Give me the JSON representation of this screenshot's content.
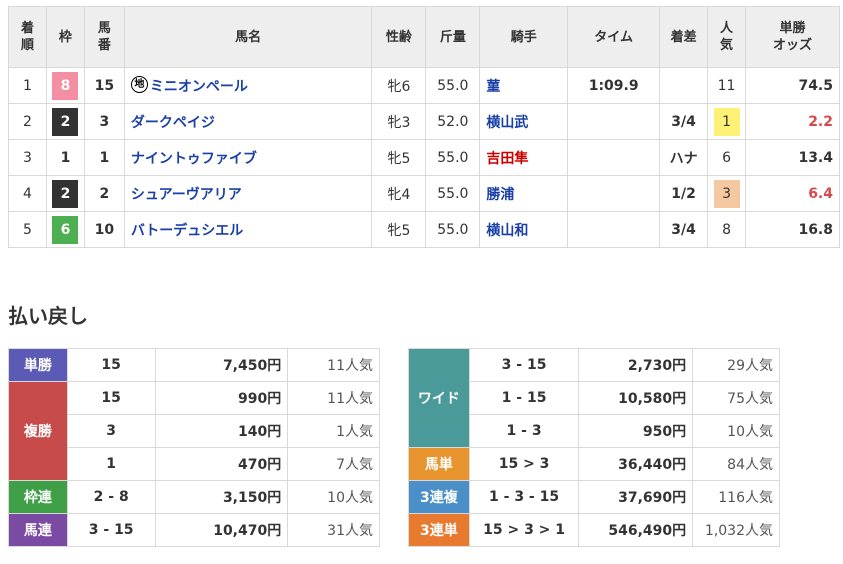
{
  "results": {
    "headers": {
      "chaku": [
        "着",
        "順"
      ],
      "waku": "枠",
      "umaban": [
        "馬",
        "番"
      ],
      "name": "馬名",
      "sexage": "性齢",
      "weight": "斤量",
      "jockey": "騎手",
      "time": "タイム",
      "margin": "着差",
      "pop": [
        "人",
        "気"
      ],
      "odds": [
        "単勝",
        "オッズ"
      ]
    },
    "rows": [
      {
        "chaku": "1",
        "waku": "8",
        "umaban": "15",
        "chi": "地",
        "name": "ミニオンペール",
        "sexage": "牝6",
        "weight": "55.0",
        "jockey": "菫",
        "time": "1:09.9",
        "margin": "",
        "pop": "11",
        "odds": "74.5"
      },
      {
        "chaku": "2",
        "waku": "2",
        "umaban": "3",
        "chi": "",
        "name": "ダークペイジ",
        "sexage": "牝3",
        "weight": "52.0",
        "jockey": "横山武",
        "time": "",
        "margin": "3/4",
        "pop": "1",
        "odds": "2.2"
      },
      {
        "chaku": "3",
        "waku": "1",
        "umaban": "1",
        "chi": "",
        "name": "ナイントゥファイブ",
        "sexage": "牝5",
        "weight": "55.0",
        "jockey": "吉田隼",
        "time": "",
        "margin": "ハナ",
        "pop": "6",
        "odds": "13.4"
      },
      {
        "chaku": "4",
        "waku": "2",
        "umaban": "2",
        "chi": "",
        "name": "シュアーヴアリア",
        "sexage": "牝4",
        "weight": "55.0",
        "jockey": "勝浦",
        "time": "",
        "margin": "1/2",
        "pop": "3",
        "odds": "6.4"
      },
      {
        "chaku": "5",
        "waku": "6",
        "umaban": "10",
        "chi": "",
        "name": "バトーデュシエル",
        "sexage": "牝5",
        "weight": "55.0",
        "jockey": "横山和",
        "time": "",
        "margin": "3/4",
        "pop": "8",
        "odds": "16.8"
      }
    ]
  },
  "payout_title": "払い戻し",
  "payout_left": [
    {
      "label": "単勝",
      "lines": [
        {
          "comb": "15",
          "amount": "7,450円",
          "pop": "11人気"
        }
      ]
    },
    {
      "label": "複勝",
      "lines": [
        {
          "comb": "15",
          "amount": "990円",
          "pop": "11人気"
        },
        {
          "comb": "3",
          "amount": "140円",
          "pop": "1人気"
        },
        {
          "comb": "1",
          "amount": "470円",
          "pop": "7人気"
        }
      ]
    },
    {
      "label": "枠連",
      "lines": [
        {
          "comb": "2 - 8",
          "amount": "3,150円",
          "pop": "10人気"
        }
      ]
    },
    {
      "label": "馬連",
      "lines": [
        {
          "comb": "3 - 15",
          "amount": "10,470円",
          "pop": "31人気"
        }
      ]
    }
  ],
  "payout_right": [
    {
      "label": "ワイド",
      "lines": [
        {
          "comb": "3 - 15",
          "amount": "2,730円",
          "pop": "29人気"
        },
        {
          "comb": "1 - 15",
          "amount": "10,580円",
          "pop": "75人気"
        },
        {
          "comb": "1 - 3",
          "amount": "950円",
          "pop": "10人気"
        }
      ]
    },
    {
      "label": "馬単",
      "lines": [
        {
          "comb": "15 > 3",
          "amount": "36,440円",
          "pop": "84人気"
        }
      ]
    },
    {
      "label": "3連複",
      "lines": [
        {
          "comb": "1 - 3 - 15",
          "amount": "37,690円",
          "pop": "116人気"
        }
      ]
    },
    {
      "label": "3連単",
      "lines": [
        {
          "comb": "15 > 3 > 1",
          "amount": "546,490円",
          "pop": "1,032人気"
        }
      ]
    }
  ],
  "colors": {
    "waku": {
      "1": {
        "bg": "#ffffff",
        "fg": "#333333"
      },
      "2": {
        "bg": "#333333",
        "fg": "#ffffff"
      },
      "6": {
        "bg": "#4caf50",
        "fg": "#ffffff"
      },
      "8": {
        "bg": "#f48fa3",
        "fg": "#ffffff"
      }
    },
    "pop_highlight": {
      "1": "#fff176",
      "2": "#e0e0e0",
      "3": "#f4c8a1"
    },
    "odds_fav": "#d84a4a",
    "jockey_red": "#cc0000",
    "jockey_blue": "#1a3fa6",
    "labels": {
      "単勝": "#5b5ab5",
      "複勝": "#c84b4b",
      "枠連": "#3e9f46",
      "馬連": "#7b4aa3",
      "ワイド": "#4a9a9a",
      "馬単": "#e8952f",
      "3連複": "#4a8fc7",
      "3連単": "#e87a2f"
    }
  }
}
